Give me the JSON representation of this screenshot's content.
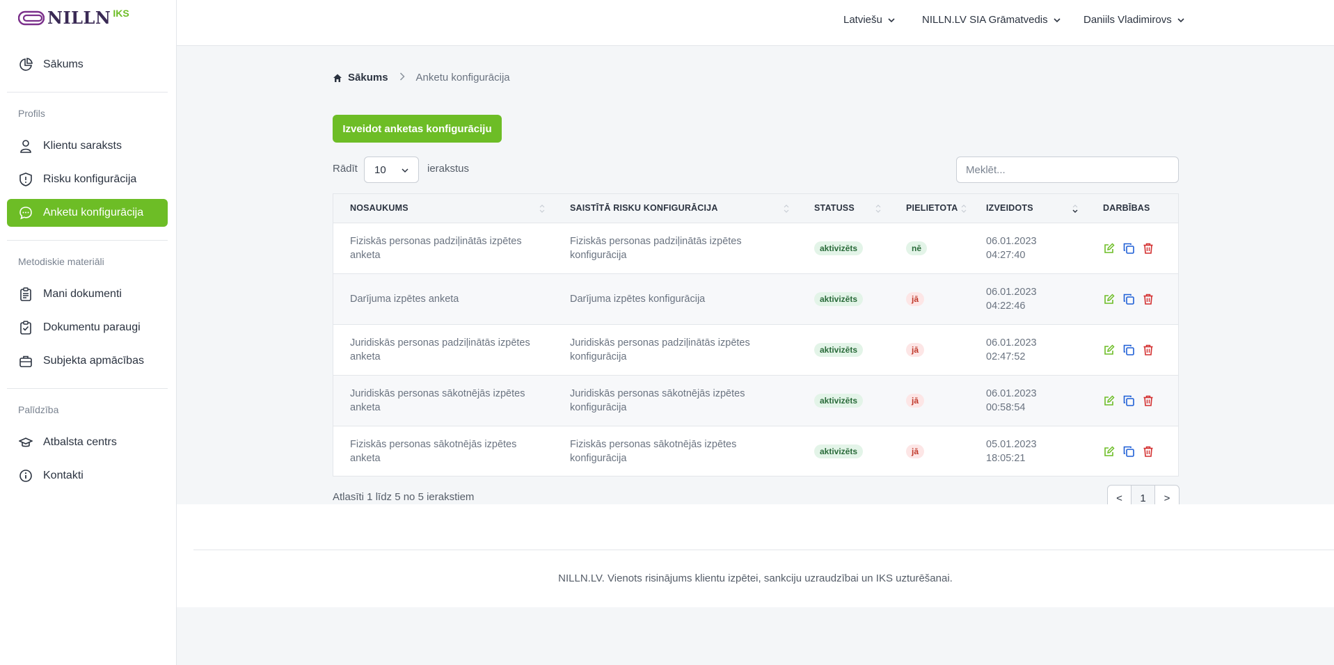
{
  "brand": {
    "name": "NILLN",
    "suffix": "IKS"
  },
  "sidebar": {
    "home_label": "Sākums",
    "sections": [
      {
        "title": "Profils",
        "items": [
          {
            "label": "Klientu saraksts",
            "icon": "user-icon"
          },
          {
            "label": "Risku konfigurācija",
            "icon": "shield-icon"
          },
          {
            "label": "Anketu konfigurācija",
            "icon": "chat-icon",
            "active": true
          }
        ]
      },
      {
        "title": "Metodiskie materiāli",
        "items": [
          {
            "label": "Mani dokumenti",
            "icon": "clipboard-icon"
          },
          {
            "label": "Dokumentu paraugi",
            "icon": "clipboard-check-icon"
          },
          {
            "label": "Subjekta apmācības",
            "icon": "briefcase-icon"
          }
        ]
      },
      {
        "title": "Palīdzība",
        "items": [
          {
            "label": "Atbalsta centrs",
            "icon": "graduation-cap-icon"
          },
          {
            "label": "Kontakti",
            "icon": "info-icon"
          }
        ]
      }
    ]
  },
  "topbar": {
    "language": "Latviešu",
    "company": "NILLN.LV SIA Grāmatvedis",
    "user": "Daniils Vladimirovs"
  },
  "breadcrumb": {
    "home": "Sākums",
    "current": "Anketu konfigurācija"
  },
  "create_button": "Izveidot anketas konfigurāciju",
  "length": {
    "label_before": "Rādīt",
    "value": "10",
    "label_after": "ierakstus"
  },
  "search": {
    "placeholder": "Meklēt..."
  },
  "table": {
    "headers": [
      "NOSAUKUMS",
      "SAISTĪTĀ RISKU KONFIGURĀCIJA",
      "STATUSS",
      "PIELIETOTA",
      "IZVEIDOTS",
      "DARBĪBAS"
    ],
    "rows": [
      {
        "name": "Fiziskās personas padziļinātās izpētes anketa",
        "risk": "Fiziskās personas padziļinātās izpētes konfigurācija",
        "status": "aktivizēts",
        "applied": "nē",
        "date": "06.01.2023",
        "time": "04:27:40"
      },
      {
        "name": "Darījuma izpētes anketa",
        "risk": "Darījuma izpētes konfigurācija",
        "status": "aktivizēts",
        "applied": "jā",
        "date": "06.01.2023",
        "time": "04:22:46"
      },
      {
        "name": "Juridiskās personas padziļinātās izpētes anketa",
        "risk": "Juridiskās personas padziļinātās izpētes konfigurācija",
        "status": "aktivizēts",
        "applied": "jā",
        "date": "06.01.2023",
        "time": "02:47:52"
      },
      {
        "name": "Juridiskās personas sākotnējās izpētes anketa",
        "risk": "Juridiskās personas sākotnējās izpētes konfigurācija",
        "status": "aktivizēts",
        "applied": "jā",
        "date": "06.01.2023",
        "time": "00:58:54"
      },
      {
        "name": "Fiziskās personas sākotnējās izpētes anketa",
        "risk": "Fiziskās personas sākotnējās izpētes konfigurācija",
        "status": "aktivizēts",
        "applied": "jā",
        "date": "05.01.2023",
        "time": "18:05:21"
      }
    ]
  },
  "info": "Atlasīti 1 līdz 5 no 5 ierakstiem",
  "pager": {
    "prev": "<",
    "current": "1",
    "next": ">"
  },
  "footer": "NILLN.LV. Vienots risinājums klientu izpētei, sankciju uzraudzībai un IKS uzturēšanai.",
  "colors": {
    "accent": "#6dbd26",
    "danger": "#d32f2f",
    "blue": "#1e5fd6"
  }
}
